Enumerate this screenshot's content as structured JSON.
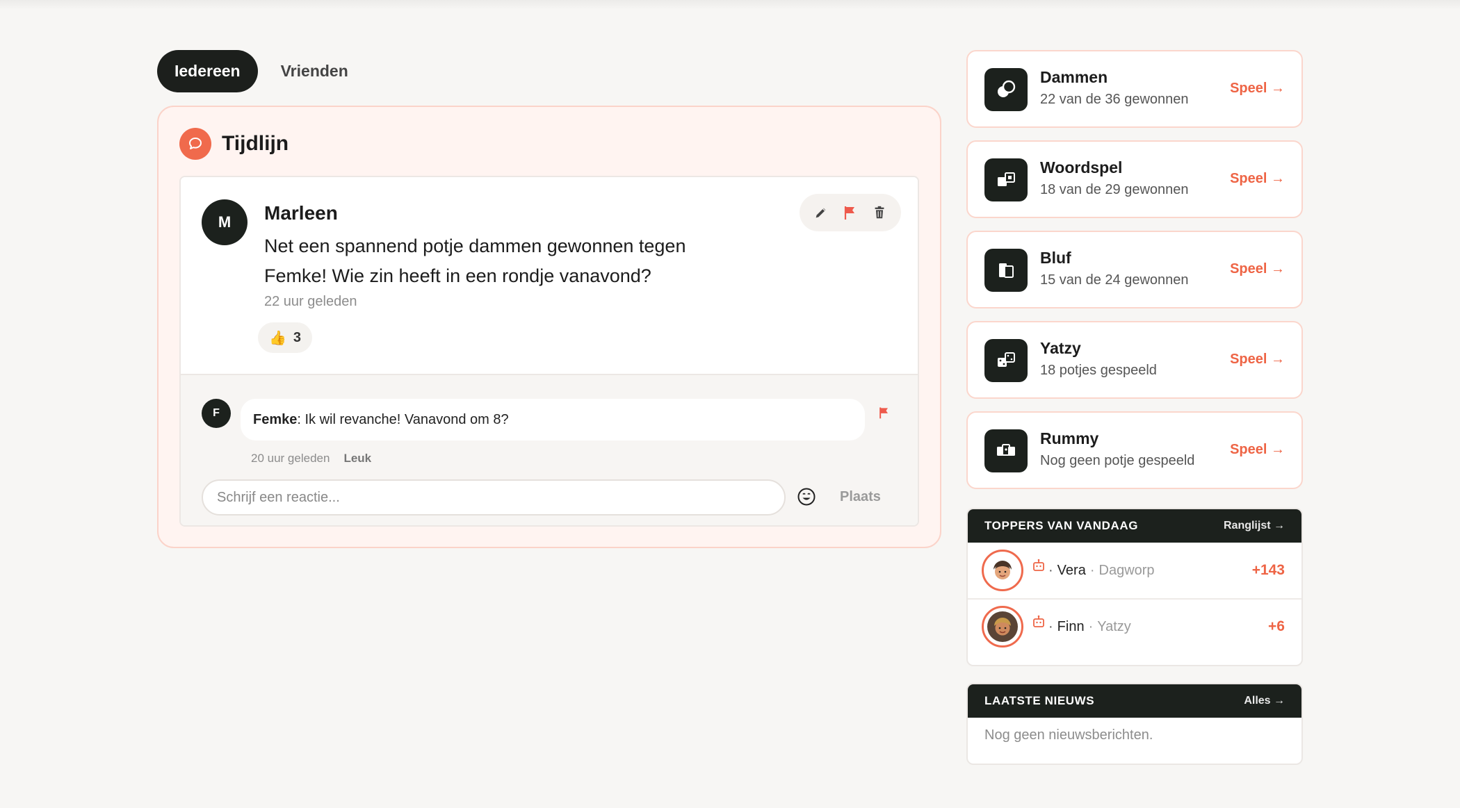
{
  "tabs": [
    {
      "label": "Iedereen",
      "active": true
    },
    {
      "label": "Vrienden",
      "active": false
    }
  ],
  "timeline": {
    "title": "Tijdlijn",
    "post": {
      "avatar_initial": "M",
      "author": "Marleen",
      "text_line1": "Net een spannend potje dammen gewonnen tegen",
      "text_line2": "Femke! Wie zin heeft in een rondje vanavond?",
      "time": "22 uur geleden",
      "likes_emoji": "👍",
      "likes": "3"
    },
    "comment": {
      "avatar_initial": "F",
      "author": "Femke",
      "separator": ":",
      "text": " Ik wil revanche! Vanavond om 8?",
      "time": "20 uur geleden",
      "like_label": "Leuk"
    },
    "reply": {
      "placeholder": "Schrijf een reactie...",
      "submit_label": "Plaats"
    }
  },
  "games": [
    {
      "name": "Dammen",
      "sub": "22 van de 36 gewonnen",
      "play": "Speel →",
      "icon": "checkers-icon"
    },
    {
      "name": "Woordspel",
      "sub": "18 van de 29 gewonnen",
      "play": "Speel →",
      "icon": "word-tiles-icon"
    },
    {
      "name": "Bluf",
      "sub": "15 van de 24 gewonnen",
      "play": "Speel →",
      "icon": "cards-icon"
    },
    {
      "name": "Yatzy",
      "sub": "18 potjes gespeeld",
      "play": "Speel →",
      "icon": "dice-icon"
    },
    {
      "name": "Rummy",
      "sub": "Nog geen potje gespeeld",
      "play": "Speel →",
      "icon": "rummy-tiles-icon"
    }
  ],
  "toppers": {
    "title": "TOPPERS VAN VANDAAG",
    "link": "Ranglijst →",
    "rows": [
      {
        "name": "Vera",
        "game": "Dagworp",
        "score": "+143",
        "dot": "·"
      },
      {
        "name": "Finn",
        "game": "Yatzy",
        "score": "+6",
        "dot": "·"
      }
    ]
  },
  "news": {
    "title": "LAATSTE NIEUWS",
    "link": "Alles →",
    "empty": "Nog geen nieuwsberichten."
  },
  "colors": {
    "accent": "#ee6445",
    "dark": "#1c211d",
    "timeline_bg": "#fff4f1"
  }
}
